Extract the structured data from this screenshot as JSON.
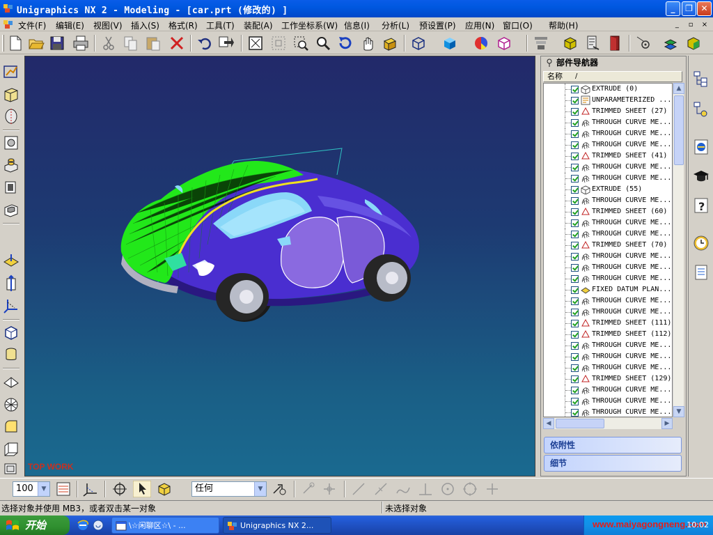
{
  "window": {
    "title": "Unigraphics NX 2 - Modeling - [car.prt  (修改的) ]",
    "caption_buttons": [
      "minimize",
      "restore",
      "close"
    ]
  },
  "menu": {
    "items": [
      "文件(F)",
      "编辑(E)",
      "视图(V)",
      "插入(S)",
      "格式(R)",
      "工具(T)",
      "装配(A)",
      "工作坐标系(W)",
      "信息(I)",
      "分析(L)",
      "预设置(P)",
      "应用(N)",
      "窗口(O)",
      "帮助(H)"
    ],
    "mdi_buttons": [
      "_",
      "▫",
      "×"
    ]
  },
  "toolbar": {
    "icons": [
      "new-icon",
      "open-icon",
      "save-icon",
      "print-icon",
      "cut-icon",
      "copy-icon",
      "paste-icon",
      "delete-icon",
      "undo-icon",
      "repeat-command-icon",
      "fit-icon",
      "zoom-window-icon",
      "zoom-fit-icon",
      "zoom-icon",
      "rotate-icon",
      "pan-icon",
      "perspective-icon",
      "wireframe-icon",
      "shaded-icon",
      "color-icon",
      "display-icon",
      "layer-icon",
      "assembly-icon",
      "measure-icon",
      "exit-icon",
      "snap-icon",
      "feature-icon",
      "component-icon"
    ]
  },
  "left_toolbar": {
    "icons": [
      "sketch-icon",
      "extrude-icon",
      "revolve-icon",
      "hole-icon",
      "boss-icon",
      "pad-icon",
      "pocket-icon",
      "datum-plane-icon",
      "datum-axis-icon",
      "csys-icon",
      "block-icon",
      "cylinder-icon",
      "cone-icon",
      "sphere-icon",
      "blend-icon",
      "chamfer-icon",
      "shell-icon"
    ]
  },
  "viewport": {
    "watermark": "TOP WORK",
    "background_top": "#22296a",
    "background_bottom": "#1a6a90"
  },
  "part_navigator": {
    "title": "部件导航器",
    "column_header": "名称",
    "sort_indicator": "/",
    "features": [
      {
        "label": "EXTRUDE  (0)",
        "icon": "extrude-feature-icon"
      },
      {
        "label": "UNPARAMETERIZED ...",
        "icon": "unparameterized-feature-icon"
      },
      {
        "label": "TRIMMED SHEET  (27)",
        "icon": "trimmed-sheet-icon"
      },
      {
        "label": "THROUGH CURVE ME...",
        "icon": "through-curve-mesh-icon"
      },
      {
        "label": "THROUGH CURVE ME...",
        "icon": "through-curve-mesh-icon"
      },
      {
        "label": "THROUGH CURVE ME...",
        "icon": "through-curve-mesh-icon"
      },
      {
        "label": "TRIMMED SHEET  (41)",
        "icon": "trimmed-sheet-icon"
      },
      {
        "label": "THROUGH CURVE ME...",
        "icon": "through-curve-mesh-icon"
      },
      {
        "label": "THROUGH CURVE ME...",
        "icon": "through-curve-mesh-icon"
      },
      {
        "label": "EXTRUDE  (55)",
        "icon": "extrude-feature-icon"
      },
      {
        "label": "THROUGH CURVE ME...",
        "icon": "through-curve-mesh-icon"
      },
      {
        "label": "TRIMMED SHEET  (60)",
        "icon": "trimmed-sheet-icon"
      },
      {
        "label": "THROUGH CURVE ME...",
        "icon": "through-curve-mesh-icon"
      },
      {
        "label": "THROUGH CURVE ME...",
        "icon": "through-curve-mesh-icon"
      },
      {
        "label": "TRIMMED SHEET  (70)",
        "icon": "trimmed-sheet-icon"
      },
      {
        "label": "THROUGH CURVE ME...",
        "icon": "through-curve-mesh-icon"
      },
      {
        "label": "THROUGH CURVE ME...",
        "icon": "through-curve-mesh-icon"
      },
      {
        "label": "THROUGH CURVE ME...",
        "icon": "through-curve-mesh-icon"
      },
      {
        "label": "FIXED DATUM PLAN...",
        "icon": "datum-plane-feature-icon"
      },
      {
        "label": "THROUGH CURVE ME...",
        "icon": "through-curve-mesh-icon"
      },
      {
        "label": "THROUGH CURVE ME...",
        "icon": "through-curve-mesh-icon"
      },
      {
        "label": "TRIMMED SHEET  (111)",
        "icon": "trimmed-sheet-icon"
      },
      {
        "label": "TRIMMED SHEET  (112)",
        "icon": "trimmed-sheet-icon"
      },
      {
        "label": "THROUGH CURVE ME...",
        "icon": "through-curve-mesh-icon"
      },
      {
        "label": "THROUGH CURVE ME...",
        "icon": "through-curve-mesh-icon"
      },
      {
        "label": "THROUGH CURVE ME...",
        "icon": "through-curve-mesh-icon"
      },
      {
        "label": "TRIMMED SHEET  (129)",
        "icon": "trimmed-sheet-icon"
      },
      {
        "label": "THROUGH CURVE ME...",
        "icon": "through-curve-mesh-icon"
      },
      {
        "label": "THROUGH CURVE ME...",
        "icon": "through-curve-mesh-icon"
      },
      {
        "label": "THROUGH CURVE ME...",
        "icon": "through-curve-mesh-icon"
      }
    ],
    "panels": [
      "依附性",
      "细节"
    ]
  },
  "resource_bar": {
    "icons": [
      "part-navigator-icon",
      "assembly-navigator-icon",
      "internet-explorer-icon",
      "training-icon",
      "help-icon",
      "history-icon",
      "roles-icon"
    ]
  },
  "bottom_toolbar": {
    "zoom_value": "100",
    "filter_value": "任何"
  },
  "status": {
    "prompt": "选择对象并使用 MB3，或者双击某一对象",
    "selection": "未选择对象"
  },
  "taskbar": {
    "start_label": "开始",
    "tasks": [
      {
        "label": "\\☆闲聊区☆\\ - ...",
        "active": false
      },
      {
        "label": "Unigraphics NX 2...",
        "active": true
      }
    ],
    "tray_text": "www.maiyagongneng.com",
    "clock": "10:02"
  },
  "colors": {
    "car_body": "#4a2ed0",
    "car_highlight_green": "#22e81a",
    "titlebar": "#0a5ce8"
  }
}
